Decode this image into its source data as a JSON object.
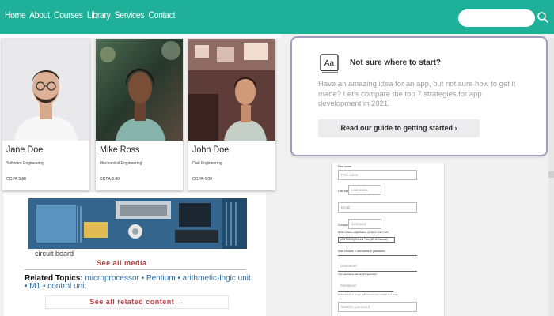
{
  "nav": {
    "links": [
      "Home",
      "About",
      "Courses",
      "Library",
      "Services",
      "Contact"
    ],
    "search_placeholder": "",
    "search_icon": "search-icon"
  },
  "students": [
    {
      "name": "Jane Doe",
      "major": "Software Engineering",
      "cgpa": "CGPA:3.80"
    },
    {
      "name": "Mike Ross",
      "major": "Mechanical Engineering",
      "cgpa": "CGPA:3.90"
    },
    {
      "name": "John Doe",
      "major": "Civil Engineering",
      "cgpa": "CGPA:4.00"
    }
  ],
  "guide": {
    "icon": "Aa",
    "title": "Not sure where to start?",
    "text": "Have an amazing idea for an app, but not sure how to get it made? Let's compare the top 7 strategies for app development in 2021!",
    "button": "Read our guide to getting started ›"
  },
  "media": {
    "caption": "circuit board",
    "see_all_media": "See all media",
    "related_label": "Related Topics:",
    "related_topics": "microprocessor • Pentium • arithmetic-logic unit • M1 • control unit",
    "see_all_related": "See all related content →"
  },
  "form": {
    "first_label": "First name",
    "first_placeholder": "First name",
    "last_label": "Last name",
    "last_placeholder": "Last name",
    "email_placeholder": "Email",
    "company_label": "Company",
    "company_placeholder": "Company",
    "company_hint": "(Enter school, organization, group or union, etc.)",
    "timezone_value": "(GMT-06:00) Central Time (US & Canada)",
    "credentials_label": "Now choose a username & password",
    "username_placeholder": "Username",
    "username_hint": "Your username can be changed later.",
    "password_placeholder": "Password",
    "password_hint": "8 characters or longer with at least one number & a letter.",
    "confirm_placeholder": "Confirm password"
  },
  "colors": {
    "nav": "#1fb09a",
    "accent_red": "#b53a3a",
    "link_blue": "#2f6ea7"
  }
}
